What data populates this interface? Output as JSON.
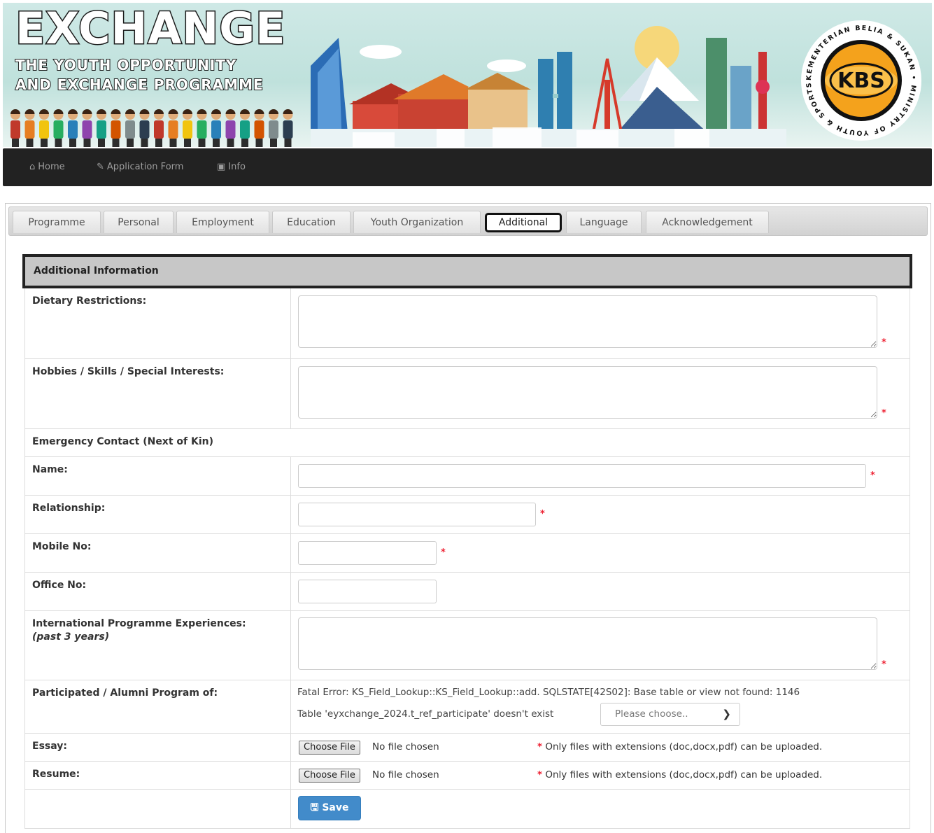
{
  "banner": {
    "title": "EXCHANGE",
    "subtitle_line1": "THE YOUTH OPPORTUNITY",
    "subtitle_line2": "AND EXCHANGE PROGRAMME",
    "logo_text": "KBS",
    "logo_ring_text": "KEMENTERIAN BELIA & SUKAN • MINISTRY OF YOUTH & SPORTS •"
  },
  "nav": {
    "items": [
      {
        "label": "Home",
        "icon": "home-icon"
      },
      {
        "label": "Application Form",
        "icon": "pencil-icon"
      },
      {
        "label": "Info",
        "icon": "image-icon"
      }
    ]
  },
  "tabs": [
    {
      "label": "Programme"
    },
    {
      "label": "Personal"
    },
    {
      "label": "Employment"
    },
    {
      "label": "Education"
    },
    {
      "label": "Youth Organization"
    },
    {
      "label": "Additional",
      "active": true
    },
    {
      "label": "Language"
    },
    {
      "label": "Acknowledgement"
    }
  ],
  "form": {
    "section_title": "Additional Information",
    "dietary_label": "Dietary Restrictions:",
    "hobbies_label": "Hobbies / Skills / Special Interests:",
    "emergency_heading": "Emergency Contact (Next of Kin)",
    "name_label": "Name:",
    "relationship_label": "Relationship:",
    "mobile_label": "Mobile No:",
    "office_label": "Office No:",
    "intl_label": "International Programme Experiences:",
    "intl_sublabel": "(past 3 years)",
    "participated_label": "Participated / Alumni Program of:",
    "error_line1": "Fatal Error: KS_Field_Lookup::KS_Field_Lookup::add. SQLSTATE[42S02]: Base table or view not found: 1146",
    "error_line2": "Table 'eyxchange_2024.t_ref_participate' doesn't exist",
    "select_placeholder": "Please choose..",
    "essay_label": "Essay:",
    "resume_label": "Resume:",
    "choose_file": "Choose File",
    "no_file": "No file chosen",
    "file_note": "Only files with extensions (doc,docx,pdf) can be uploaded.",
    "required_mark": "*",
    "save_label": "Save"
  },
  "colors": {
    "navbar": "#222222",
    "section_header": "#c7c7c7",
    "save_button": "#428bca",
    "required": "#e22233"
  }
}
